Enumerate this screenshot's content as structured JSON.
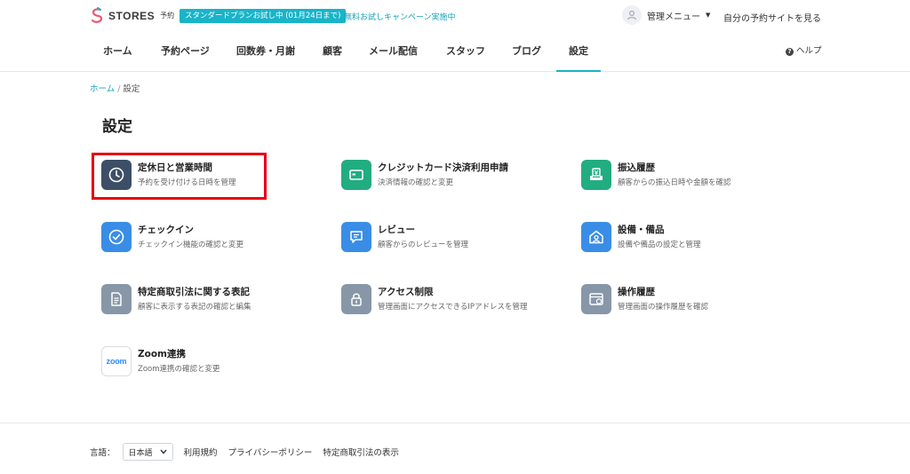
{
  "header": {
    "brand": "STORES",
    "brand_sub": "予約",
    "plan_badge": "スタンダードプランお試し中 (01月24日まで)",
    "campaign_link": "無料お試しキャンペーン実施中",
    "admin_menu": "管理メニュー",
    "own_site_link": "自分の予約サイトを見る"
  },
  "nav": {
    "items": [
      "ホーム",
      "予約ページ",
      "回数券・月謝",
      "顧客",
      "メール配信",
      "スタッフ",
      "ブログ",
      "設定"
    ],
    "active": "設定",
    "help": "ヘルプ"
  },
  "breadcrumb": {
    "home": "ホーム",
    "separator": "/",
    "current": "設定"
  },
  "page_title": "設定",
  "cards": [
    {
      "title": "定休日と営業時間",
      "desc": "予約を受け付ける日時を管理",
      "icon": "clock-icon",
      "color": "#3c4f66"
    },
    {
      "title": "クレジットカード決済利用申請",
      "desc": "決済情報の確認と変更",
      "icon": "credit-card-icon",
      "color": "#21ad80"
    },
    {
      "title": "振込履歴",
      "desc": "顧客からの振込日時や金額を確認",
      "icon": "yen-tray-icon",
      "color": "#21ad80"
    },
    {
      "title": "チェックイン",
      "desc": "チェックイン機能の確認と変更",
      "icon": "check-circle-icon",
      "color": "#3a8de6"
    },
    {
      "title": "レビュー",
      "desc": "顧客からのレビューを管理",
      "icon": "review-icon",
      "color": "#3a8de6"
    },
    {
      "title": "設備・備品",
      "desc": "設備や備品の設定と管理",
      "icon": "facility-icon",
      "color": "#3a8de6"
    },
    {
      "title": "特定商取引法に関する表記",
      "desc": "顧客に表示する表記の確認と編集",
      "icon": "document-icon",
      "color": "#8797a8"
    },
    {
      "title": "アクセス制限",
      "desc": "管理画面にアクセスできるIPアドレスを管理",
      "icon": "lock-icon",
      "color": "#8797a8"
    },
    {
      "title": "操作履歴",
      "desc": "管理画面の操作履歴を確認",
      "icon": "history-icon",
      "color": "#8797a8"
    },
    {
      "title": "Zoom連携",
      "desc": "Zoom連携の確認と変更",
      "icon": "zoom-logo-icon",
      "color": "#2d8cff"
    }
  ],
  "zoom_logo_text": "zoom",
  "footer": {
    "language_label": "言語：",
    "language_value": "日本語",
    "links": [
      "利用規約",
      "プライバシーポリシー",
      "特定商取引法の表示"
    ]
  },
  "colors": {
    "accent": "#19b4c8",
    "highlight_border": "#e60012"
  }
}
